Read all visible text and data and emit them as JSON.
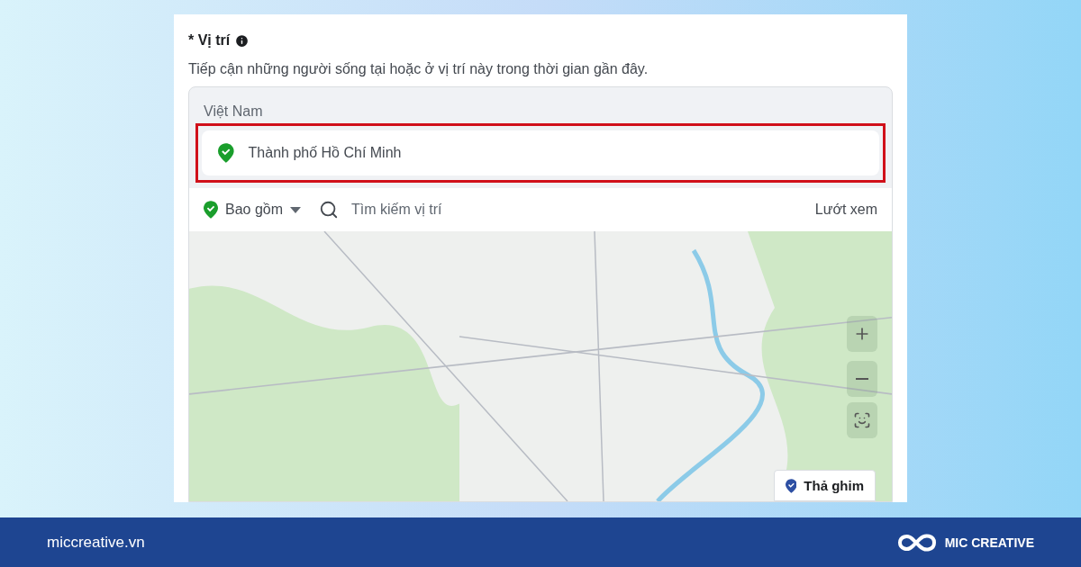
{
  "section": {
    "title": "* Vị trí",
    "description": "Tiếp cận những người sống tại hoặc ở vị trí này trong thời gian gần đây."
  },
  "locations": {
    "country": "Việt Nam",
    "items": [
      {
        "name": "Thành phố Hồ Chí Minh",
        "highlighted": true
      }
    ]
  },
  "toolbar": {
    "mode": "Bao gồm",
    "search_placeholder": "Tìm kiếm vị trí",
    "browse": "Lướt xem"
  },
  "map": {
    "drop_pin": "Thả ghim"
  },
  "footer": {
    "website": "miccreative.vn",
    "brand": "MIC CREATIVE"
  }
}
